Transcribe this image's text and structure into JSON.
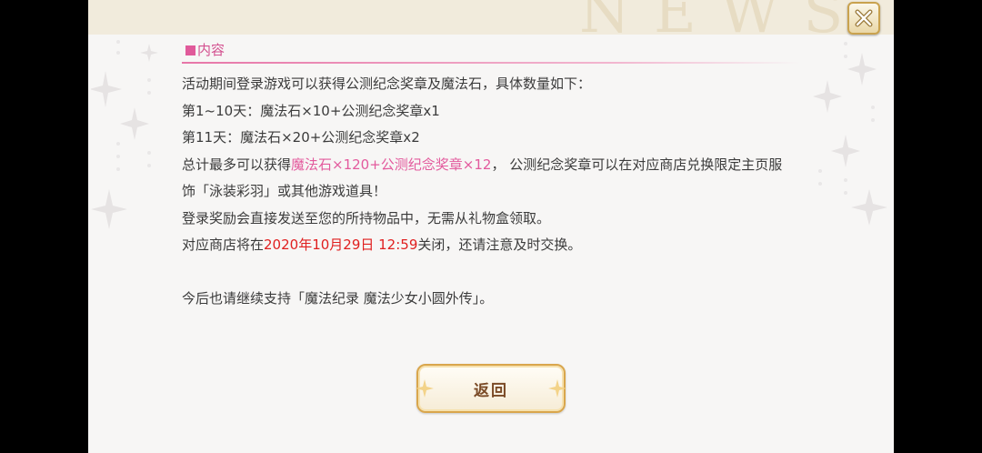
{
  "header": {
    "watermark": "NEWS"
  },
  "section": {
    "title": "内容"
  },
  "content": {
    "line1": "活动期间登录游戏可以获得公测纪念奖章及魔法石，具体数量如下：",
    "line2": "第1~10天：魔法石×10+公测纪念奖章x1",
    "line3": "第11天：魔法石×20+公测纪念奖章x2",
    "line4_prefix": "总计最多可以获得",
    "line4_highlight": "魔法石×120+公测纪念奖章×12",
    "line4_suffix": "， 公测纪念奖章可以在对应商店兑换限定主页服",
    "line5": "饰「泳装彩羽」或其他游戏道具！",
    "line6": "登录奖励会直接发送至您的所持物品中，无需从礼物盒领取。",
    "line7_prefix": "对应商店将在",
    "line7_date": "2020年10月29日 12:59",
    "line7_suffix": "关闭，还请注意及时交换。",
    "line8": "今后也请继续支持「魔法纪录 魔法少女小圆外传」。"
  },
  "buttons": {
    "back_label": "返回"
  },
  "icons": {
    "close": "close-icon",
    "section_marker": "square-icon"
  },
  "colors": {
    "highlight_pink": "#e35a9d",
    "date_red": "#e01f1f",
    "gold": "#c9a24e"
  }
}
